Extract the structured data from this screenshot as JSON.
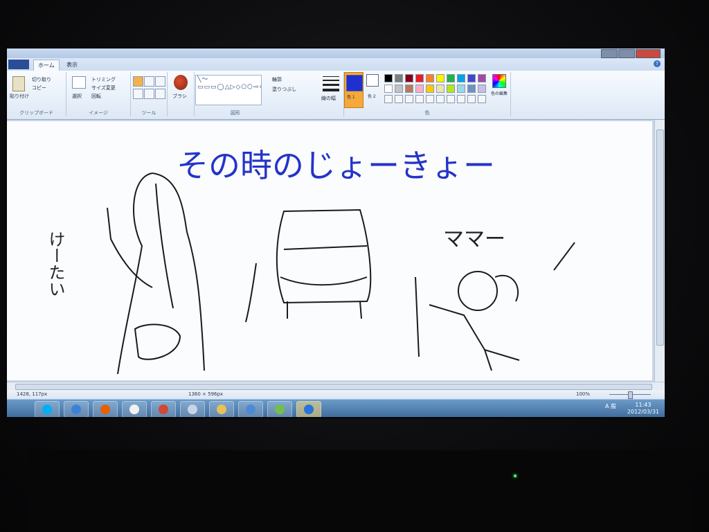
{
  "app": {
    "menu_label": "",
    "tabs": [
      "ホーム",
      "表示"
    ],
    "help": "?"
  },
  "ribbon": {
    "clipboard": {
      "paste": "貼り付け",
      "cut": "切り取り",
      "copy": "コピー",
      "label": "クリップボード"
    },
    "image": {
      "select": "選択",
      "crop": "トリミング",
      "resize": "サイズ変更",
      "rotate": "回転",
      "label": "イメージ"
    },
    "tools": {
      "label": "ツール"
    },
    "brush": {
      "label": "ブラシ"
    },
    "shapes": {
      "label": "図形",
      "outline": "輪郭",
      "fill": "塗りつぶし",
      "glyphs": "╲〜▭▭▭◯△▷◇⬠⬡⇨⇦⇧⇩✦☆✶▭▭♡⚡"
    },
    "size": {
      "label": "線の幅"
    },
    "colors": {
      "color1_label": "色 1",
      "color2_label": "色 2",
      "edit_label": "色の編集",
      "label": "色",
      "color1": "#1f2fd0",
      "color2": "#ffffff",
      "palette_row1": [
        "#000000",
        "#7f7f7f",
        "#880015",
        "#ed1c24",
        "#ff7f27",
        "#fff200",
        "#22b14c",
        "#00a2e8",
        "#3f48cc",
        "#a349a4"
      ],
      "palette_row2": [
        "#ffffff",
        "#c3c3c3",
        "#b97a57",
        "#ffaec9",
        "#ffc90e",
        "#efe4b0",
        "#b5e61d",
        "#99d9ea",
        "#7092be",
        "#c8bfe7"
      ]
    }
  },
  "canvas_text": {
    "title": "その時のじょーきょー",
    "left_note": "けーたい",
    "right_note": "ママー"
  },
  "status": {
    "cursor": "1428, 117px",
    "size": "1360 × 596px",
    "zoom": "100%"
  },
  "taskbar": {
    "apps": [
      {
        "name": "skype-icon",
        "color": "#00aff0"
      },
      {
        "name": "itunes-icon",
        "color": "#3b82d6"
      },
      {
        "name": "firefox-icon",
        "color": "#e66000"
      },
      {
        "name": "paint-icon",
        "color": "#f2f2f2"
      },
      {
        "name": "chrome-icon",
        "color": "#d14836"
      },
      {
        "name": "disc-icon",
        "color": "#c9d4e2"
      },
      {
        "name": "folder-icon",
        "color": "#e8c15a"
      },
      {
        "name": "outlook-icon",
        "color": "#4d8ad6"
      },
      {
        "name": "globe-icon",
        "color": "#6fbf4a"
      },
      {
        "name": "itunes-active-icon",
        "color": "#2a73d9"
      }
    ],
    "tray_ime": "A 般",
    "time": "11:43",
    "date": "2012/03/31"
  }
}
